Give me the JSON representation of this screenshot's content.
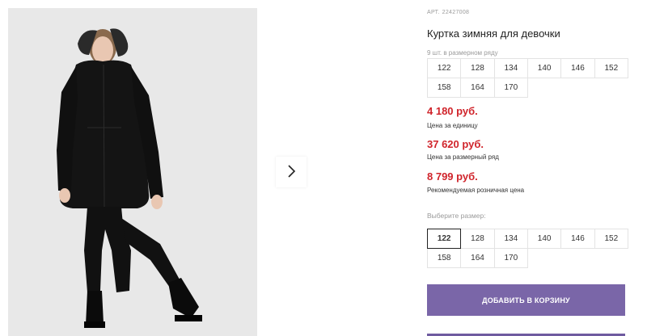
{
  "product": {
    "article_label": "АРТ.",
    "article_number": "22427008",
    "title": "Куртка зимняя для девочки",
    "pack_label": "9 шт. в размерном ряду"
  },
  "pack_sizes": [
    "122",
    "128",
    "134",
    "140",
    "146",
    "152",
    "158",
    "164",
    "170"
  ],
  "prices": {
    "unit_price": "4 180 руб.",
    "unit_note": "Цена за единицу",
    "pack_price": "37 620 руб.",
    "pack_note": "Цена за размерный ряд",
    "retail_price": "8 799 руб.",
    "retail_note": "Рекомендуемая розничная цена"
  },
  "size_select": {
    "label": "Выберите размер:",
    "options": [
      "122",
      "128",
      "134",
      "140",
      "146",
      "152",
      "158",
      "164",
      "170"
    ],
    "selected": "122"
  },
  "actions": {
    "add_to_cart": "ДОБАВИТЬ В КОРЗИНУ"
  },
  "gallery": {
    "next_icon": "chevron-right-icon"
  },
  "colors": {
    "price": "#d0242b",
    "button": "#7a66a8"
  }
}
